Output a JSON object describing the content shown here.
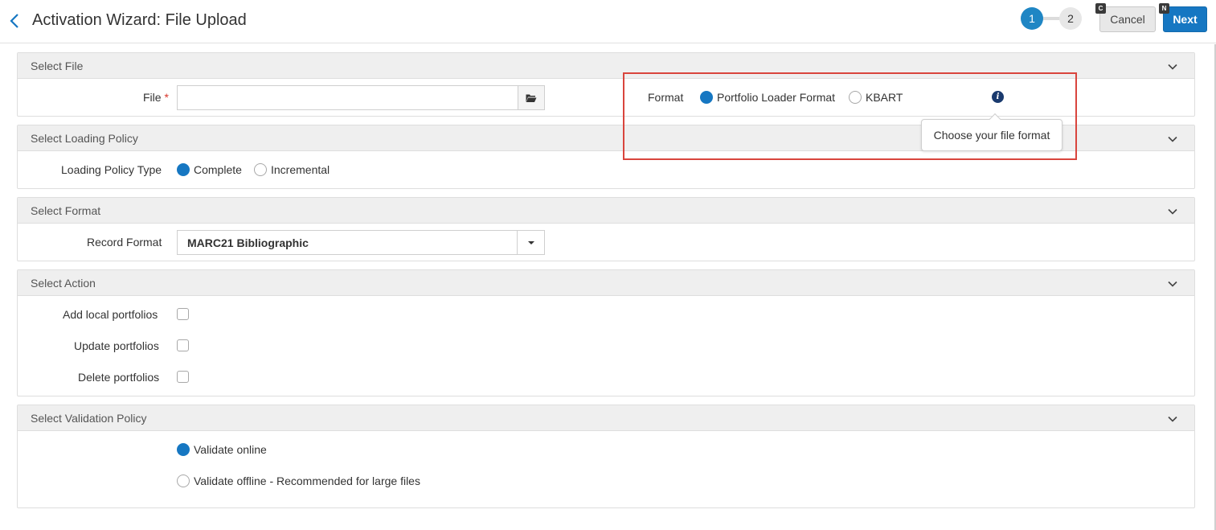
{
  "header": {
    "title": "Activation Wizard: File Upload",
    "steps": [
      "1",
      "2"
    ],
    "cancel_label": "Cancel",
    "cancel_hotkey": "C",
    "next_label": "Next",
    "next_hotkey": "N"
  },
  "sections": {
    "file": {
      "title": "Select File",
      "file_label": "File",
      "required_mark": "*",
      "file_value": "",
      "format_label": "Format",
      "format_options": [
        "Portfolio Loader Format",
        "KBART"
      ],
      "format_selected": "Portfolio Loader Format",
      "tooltip": "Choose your file format"
    },
    "loading_policy": {
      "title": "Select Loading Policy",
      "label": "Loading Policy Type",
      "options": [
        "Complete",
        "Incremental"
      ],
      "selected": "Complete"
    },
    "format": {
      "title": "Select Format",
      "label": "Record Format",
      "value": "MARC21 Bibliographic"
    },
    "action": {
      "title": "Select Action",
      "checkboxes": [
        {
          "label": "Add local portfolios",
          "checked": false
        },
        {
          "label": "Update portfolios",
          "checked": false
        },
        {
          "label": "Delete portfolios",
          "checked": false
        }
      ]
    },
    "validation": {
      "title": "Select Validation Policy",
      "options": [
        "Validate online",
        "Validate offline - Recommended for large files"
      ],
      "selected": "Validate online"
    }
  },
  "colors": {
    "accent": "#1677c2",
    "step_active": "#1f86c4",
    "required": "#d9362b",
    "highlight": "#d9453d",
    "info_icon": "#1a3a6e"
  },
  "icons": {
    "back": "chevron-left-icon",
    "folder": "folder-open-icon",
    "caret": "caret-down-icon",
    "collapse": "chevron-down-icon",
    "info": "info-icon"
  }
}
